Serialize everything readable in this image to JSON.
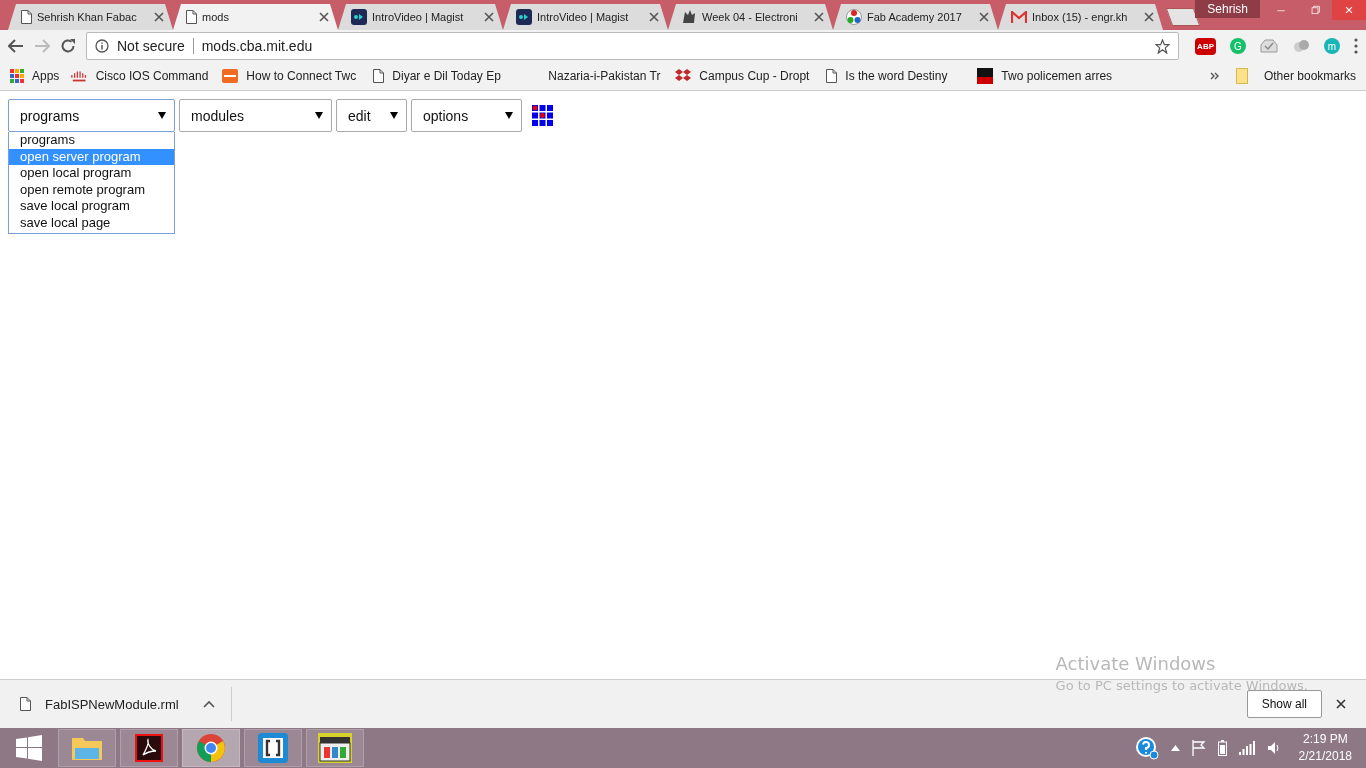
{
  "window": {
    "user": "Sehrish"
  },
  "tabs": [
    {
      "title": "Sehrish Khan Fabac",
      "kind": "page",
      "selected": false
    },
    {
      "title": "mods",
      "kind": "page",
      "selected": true
    },
    {
      "title": "IntroVideo | Magist",
      "kind": "video",
      "selected": false
    },
    {
      "title": "IntroVideo | Magist",
      "kind": "video",
      "selected": false
    },
    {
      "title": "Week 04 - Electroni",
      "kind": "bird",
      "selected": false
    },
    {
      "title": "Fab Academy 2017",
      "kind": "fab",
      "selected": false
    },
    {
      "title": "Inbox (15) - engr.kh",
      "kind": "mail",
      "selected": false
    }
  ],
  "address": {
    "security": "Not secure",
    "url": "mods.cba.mit.edu"
  },
  "extensions": [
    {
      "kind": "stop",
      "label": "ABP"
    },
    {
      "kind": "circle",
      "label": "G",
      "color": "#15c26b"
    },
    {
      "kind": "tray"
    },
    {
      "kind": "cloud"
    },
    {
      "kind": "circle",
      "label": "m",
      "color": "#1bb5b5"
    }
  ],
  "bookmarks": [
    {
      "label": "Apps",
      "kind": "apps"
    },
    {
      "label": "Cisco IOS Command",
      "kind": "cisco"
    },
    {
      "label": "How to Connect Twc",
      "kind": "ott"
    },
    {
      "label": "Diyar e Dil Today Ep",
      "kind": "page"
    },
    {
      "label": "Nazaria-i-Pakistan Tr",
      "kind": "none"
    },
    {
      "label": "Campus Cup - Dropt",
      "kind": "dropbox"
    },
    {
      "label": "Is the word Destiny",
      "kind": "page"
    },
    {
      "label": "Two policemen arres",
      "kind": "news"
    }
  ],
  "other_bookmarks": "Other bookmarks",
  "menus": [
    {
      "label": "programs",
      "open": true,
      "options": [
        {
          "label": "programs",
          "selected": false
        },
        {
          "label": "open server program",
          "selected": true
        },
        {
          "label": "open local program",
          "selected": false
        },
        {
          "label": "open remote program",
          "selected": false
        },
        {
          "label": "save local program",
          "selected": false
        },
        {
          "label": "save local page",
          "selected": false
        }
      ]
    },
    {
      "label": "modules",
      "open": false
    },
    {
      "label": "edit",
      "open": false
    },
    {
      "label": "options",
      "open": false
    }
  ],
  "activation": {
    "title": "Activate Windows",
    "subtitle": "Go to PC settings to activate Windows."
  },
  "download": {
    "file": "FabISPNewModule.rml",
    "show_all": "Show all"
  },
  "taskbar": {
    "apps": [
      {
        "kind": "folder",
        "selected": false
      },
      {
        "kind": "acrobat",
        "selected": false
      },
      {
        "kind": "chrome",
        "selected": true
      },
      {
        "kind": "brackets",
        "selected": false
      },
      {
        "kind": "clapper",
        "selected": false
      }
    ],
    "time": "2:19 PM",
    "date": "2/21/2018"
  }
}
